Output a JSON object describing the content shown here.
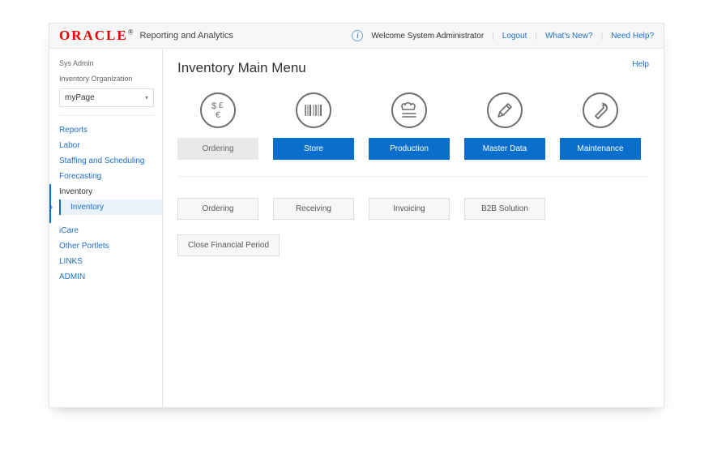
{
  "header": {
    "logo_text": "ORACLE",
    "app_title": "Reporting and Analytics",
    "welcome": "Welcome System Administrator",
    "links": {
      "logout": "Logout",
      "whats_new": "What's New?",
      "need_help": "Need Help?"
    }
  },
  "sidebar": {
    "user_line": "Sys Admin",
    "org_line": "Inventory Organization",
    "select_value": "myPage",
    "nav": [
      {
        "label": "Reports"
      },
      {
        "label": "Labor"
      },
      {
        "label": "Staffing and Scheduling"
      },
      {
        "label": "Forecasting"
      },
      {
        "label": "Inventory",
        "active": true,
        "children": [
          {
            "label": "Inventory"
          }
        ]
      },
      {
        "label": "iCare"
      },
      {
        "label": "Other Portlets"
      },
      {
        "label": "LINKS"
      },
      {
        "label": "ADMIN"
      }
    ]
  },
  "main": {
    "title": "Inventory Main Menu",
    "help": "Help",
    "categories": [
      {
        "label": "Ordering",
        "icon": "currency-icon",
        "style": "secondary"
      },
      {
        "label": "Store",
        "icon": "barcode-icon",
        "style": "primary"
      },
      {
        "label": "Production",
        "icon": "chef-icon",
        "style": "primary"
      },
      {
        "label": "Master Data",
        "icon": "pencil-icon",
        "style": "primary"
      },
      {
        "label": "Maintenance",
        "icon": "wrench-icon",
        "style": "primary"
      }
    ],
    "actions": [
      {
        "label": "Ordering"
      },
      {
        "label": "Receiving"
      },
      {
        "label": "Invoicing"
      },
      {
        "label": "B2B Solution"
      },
      {
        "label": "Close Financial Period"
      }
    ]
  }
}
